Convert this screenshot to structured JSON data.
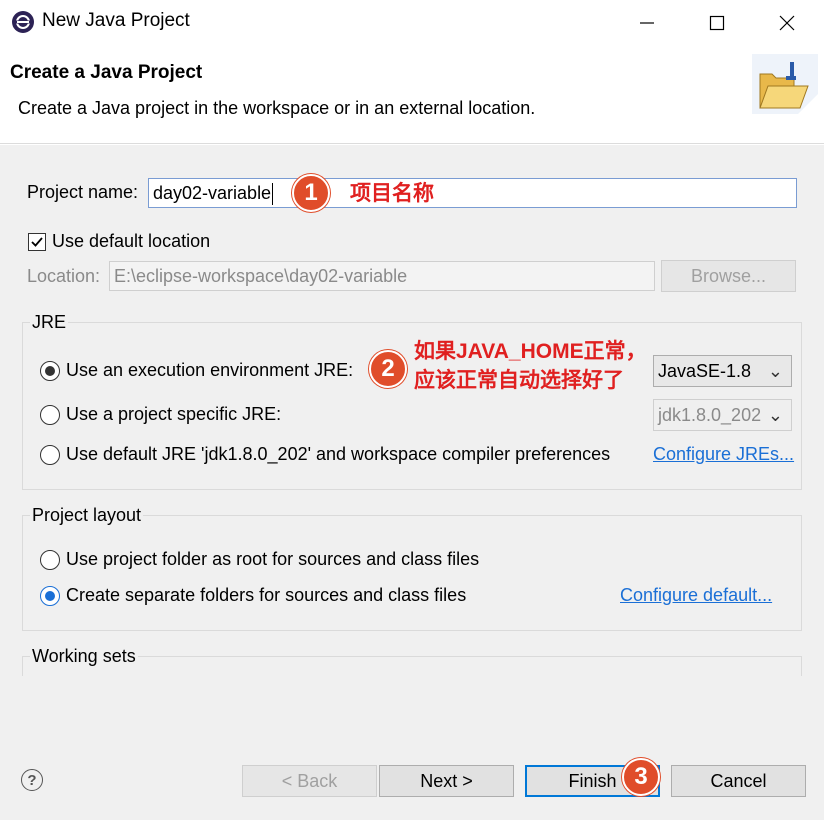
{
  "window": {
    "title": "New Java Project"
  },
  "header": {
    "title": "Create a Java Project",
    "description": "Create a Java project in the workspace or in an external location."
  },
  "project": {
    "name_label": "Project name:",
    "name_value": "day02-variable",
    "use_default_location_label": "Use default location",
    "use_default_location_checked": true,
    "location_label": "Location:",
    "location_value": "E:\\eclipse-workspace\\day02-variable",
    "browse_label": "Browse..."
  },
  "jre": {
    "title": "JRE",
    "options": [
      {
        "label": "Use an execution environment JRE:",
        "checked": true
      },
      {
        "label": "Use a project specific JRE:",
        "checked": false
      },
      {
        "label": "Use default JRE 'jdk1.8.0_202' and workspace compiler preferences",
        "checked": false
      }
    ],
    "env_combo_value": "JavaSE-1.8",
    "specific_combo_value": "jdk1.8.0_202",
    "configure_link": "Configure JREs..."
  },
  "layout": {
    "title": "Project layout",
    "options": [
      {
        "label": "Use project folder as root for sources and class files",
        "checked": false
      },
      {
        "label": "Create separate folders for sources and class files",
        "checked": true
      }
    ],
    "configure_link": "Configure default..."
  },
  "working_sets": {
    "title": "Working sets"
  },
  "footer": {
    "back_label": "< Back",
    "next_label": "Next >",
    "finish_label": "Finish",
    "cancel_label": "Cancel",
    "help_symbol": "?"
  },
  "annotations": {
    "badge1": "1",
    "badge2": "2",
    "badge3": "3",
    "note1": "项目名称",
    "note2_line1": "如果JAVA_HOME正常，",
    "note2_line2": "应该正常自动选择好了"
  },
  "colors": {
    "accent": "#1a6fd6",
    "annotation": "#e02020",
    "badge": "#e04d2a"
  }
}
